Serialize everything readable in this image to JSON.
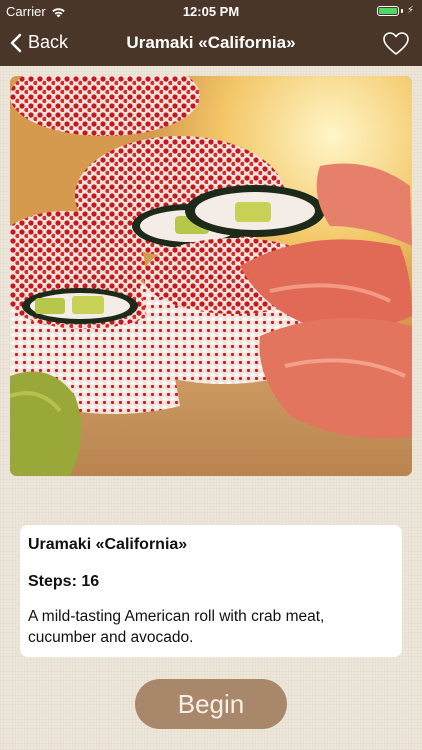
{
  "status_bar": {
    "carrier": "Carrier",
    "time": "12:05 PM",
    "battery_level": 1.0,
    "icons": [
      "wifi-icon",
      "battery-icon",
      "charging-icon"
    ]
  },
  "nav": {
    "back_label": "Back",
    "title": "Uramaki «California»",
    "back_icon": "chevron-left-icon",
    "favorite_icon": "heart-outline-icon"
  },
  "hero": {
    "description_icon": "food-photo"
  },
  "recipe": {
    "name": "Uramaki «California»",
    "steps": "Steps: 16",
    "description": "A mild-tasting American roll with crab meat, cucumber and avocado."
  },
  "actions": {
    "begin_label": "Begin"
  },
  "colors": {
    "header": "#4a3529",
    "background": "#ede6da",
    "card": "#ffffff",
    "button": "#a9876b",
    "button_text": "#f5efe8"
  }
}
